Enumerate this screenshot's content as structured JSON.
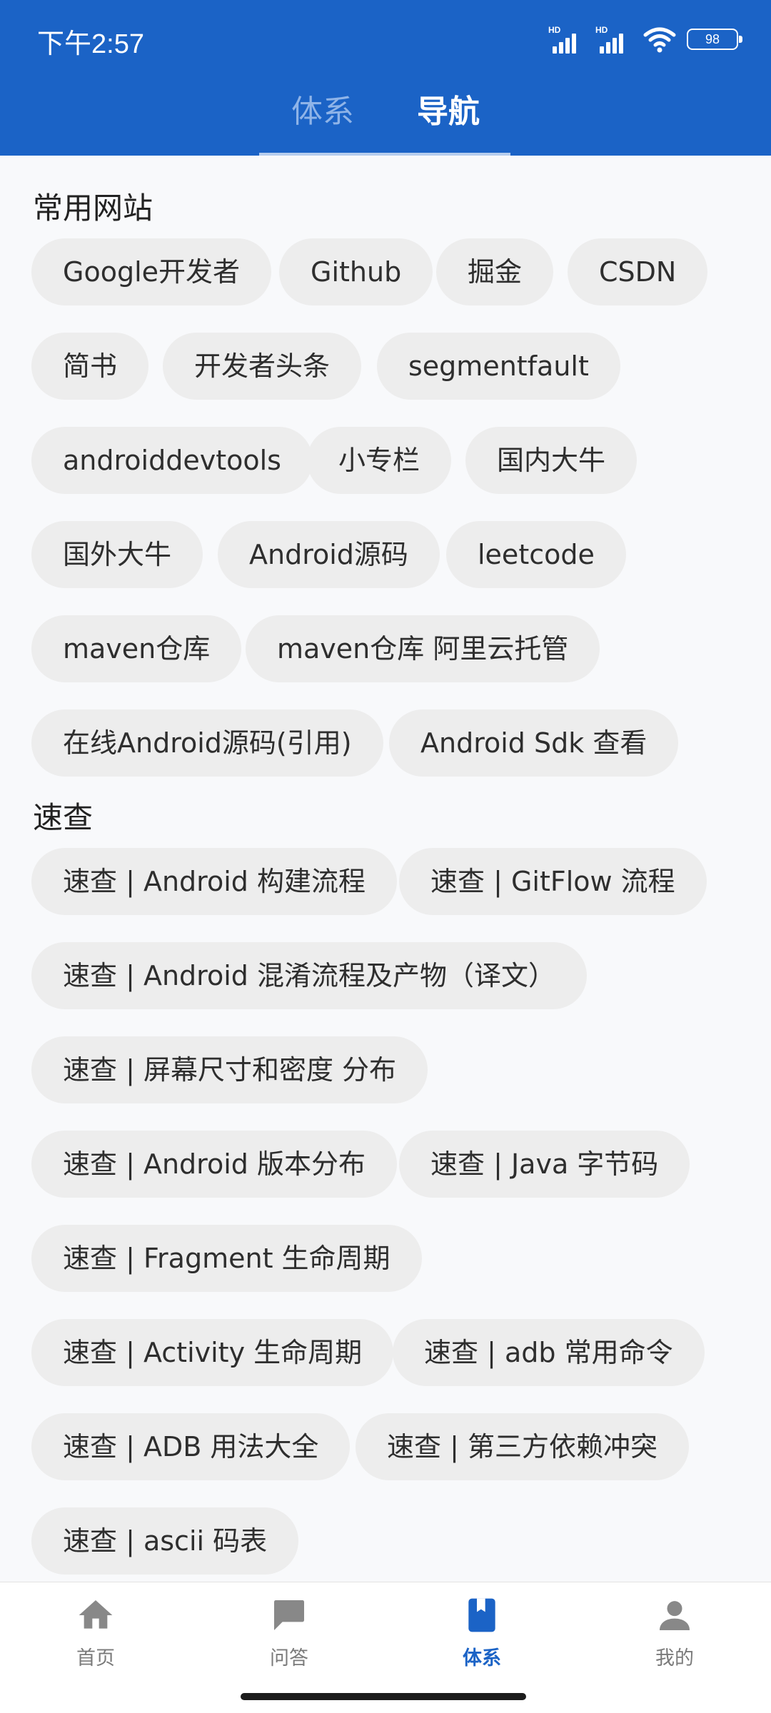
{
  "status_bar": {
    "time": "下午2:57",
    "network_label": "HD",
    "battery": "98"
  },
  "top_tabs": [
    {
      "label": "体系",
      "selected": false
    },
    {
      "label": "导航",
      "selected": true
    }
  ],
  "sections": [
    {
      "title": "常用网站",
      "items": [
        "Google开发者",
        "Github",
        "掘金",
        "CSDN",
        "简书",
        "开发者头条",
        "segmentfault",
        "androiddevtools",
        "小专栏",
        "国内大牛",
        "国外大牛",
        "Android源码",
        "leetcode",
        "maven仓库",
        "maven仓库 阿里云托管",
        "在线Android源码(引用)",
        "Android Sdk 查看"
      ]
    },
    {
      "title": "速查",
      "items": [
        "速查 | Android 构建流程",
        "速查 | GitFlow 流程",
        "速查 | Android 混淆流程及产物（译文）",
        "速查 | 屏幕尺寸和密度 分布",
        "速查 | Android 版本分布",
        "速查 | Java 字节码",
        "速查 | Fragment 生命周期",
        "速查 | Activity 生命周期",
        "速查 | adb 常用命令",
        "速查 | ADB 用法大全",
        "速查 | 第三方依赖冲突",
        "速查 | ascii 码表"
      ]
    }
  ],
  "bottom_nav": [
    {
      "label": "首页",
      "icon": "home-icon",
      "active": false
    },
    {
      "label": "问答",
      "icon": "chat-icon",
      "active": false
    },
    {
      "label": "体系",
      "icon": "bookmark-book-icon",
      "active": true
    },
    {
      "label": "我的",
      "icon": "person-icon",
      "active": false
    }
  ],
  "colors": {
    "primary": "#1b63c6",
    "chip_background": "#ededed",
    "page_background": "#f8f9fb"
  }
}
